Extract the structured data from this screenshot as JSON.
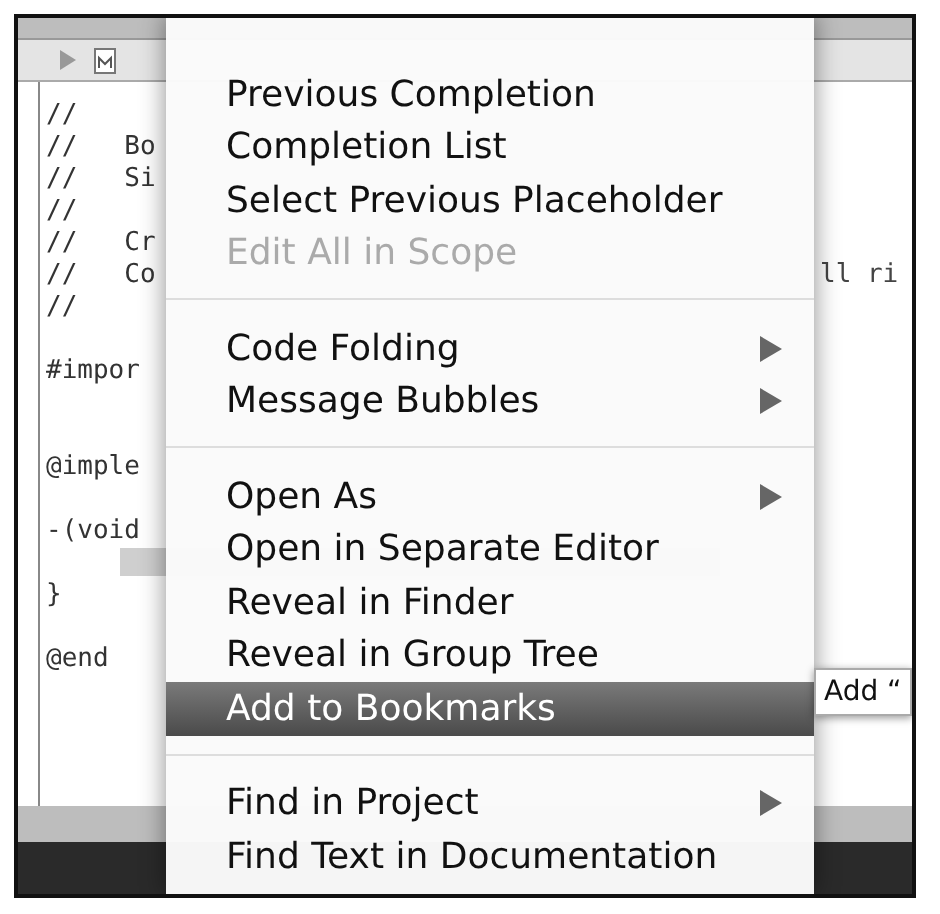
{
  "editor": {
    "lines": [
      {
        "kind": "code",
        "text": "//"
      },
      {
        "kind": "code",
        "text": "//   Bo"
      },
      {
        "kind": "code",
        "text": "//   Si"
      },
      {
        "kind": "code",
        "text": "//"
      },
      {
        "kind": "code",
        "text": "//   Cr"
      },
      {
        "kind": "code",
        "text": "//   Co",
        "right": "ll ri"
      },
      {
        "kind": "code",
        "text": "//"
      },
      {
        "kind": "blank"
      },
      {
        "kind": "code",
        "text": "#impor"
      },
      {
        "kind": "blank"
      },
      {
        "kind": "blank"
      },
      {
        "kind": "code",
        "text": "@imple"
      },
      {
        "kind": "blank"
      },
      {
        "kind": "code",
        "text": "-(void"
      },
      {
        "kind": "selection"
      },
      {
        "kind": "code",
        "text": "}"
      },
      {
        "kind": "blank"
      },
      {
        "kind": "code",
        "text": "@end"
      }
    ]
  },
  "context_menu": {
    "groups": [
      [
        {
          "label": "Previous Completion",
          "disabled": false,
          "submenu": false,
          "selected": false
        },
        {
          "label": "Completion List",
          "disabled": false,
          "submenu": false,
          "selected": false
        },
        {
          "label": "Select Previous Placeholder",
          "disabled": false,
          "submenu": false,
          "selected": false
        },
        {
          "label": "Edit All in Scope",
          "disabled": true,
          "submenu": false,
          "selected": false
        }
      ],
      [
        {
          "label": "Code Folding",
          "disabled": false,
          "submenu": true,
          "selected": false
        },
        {
          "label": "Message Bubbles",
          "disabled": false,
          "submenu": true,
          "selected": false
        }
      ],
      [
        {
          "label": "Open As",
          "disabled": false,
          "submenu": true,
          "selected": false
        },
        {
          "label": "Open in Separate Editor",
          "disabled": false,
          "submenu": false,
          "selected": false
        },
        {
          "label": "Reveal in Finder",
          "disabled": false,
          "submenu": false,
          "selected": false
        },
        {
          "label": "Reveal in Group Tree",
          "disabled": false,
          "submenu": false,
          "selected": false
        },
        {
          "label": "Add to Bookmarks",
          "disabled": false,
          "submenu": false,
          "selected": true
        }
      ],
      [
        {
          "label": "Find in Project",
          "disabled": false,
          "submenu": true,
          "selected": false
        },
        {
          "label": "Find Text in Documentation",
          "disabled": false,
          "submenu": false,
          "selected": false
        }
      ]
    ]
  },
  "tooltip": {
    "text": "Add “"
  }
}
